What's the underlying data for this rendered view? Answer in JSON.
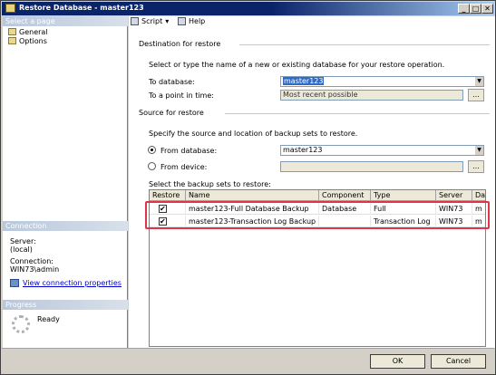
{
  "window": {
    "title": "Restore Database - master123",
    "min": "_",
    "max": "□",
    "close": "✕"
  },
  "sidebar": {
    "select_page_header": "Select a page",
    "items": [
      {
        "label": "General"
      },
      {
        "label": "Options"
      }
    ],
    "connection_header": "Connection",
    "server_label": "Server:",
    "server_value": "(local)",
    "connection_label": "Connection:",
    "connection_value": "WIN73\\admin",
    "view_props_link": "View connection properties",
    "progress_header": "Progress",
    "progress_status": "Ready"
  },
  "toolbar": {
    "script_label": "Script",
    "script_arrow": "▾",
    "help_label": "Help"
  },
  "destination": {
    "group_title": "Destination for restore",
    "description": "Select or type the name of a new or existing database for your restore operation.",
    "to_database_label": "To database:",
    "to_database_value": "master123",
    "point_in_time_label": "To a point in time:",
    "point_in_time_value": "Most recent possible",
    "ellipsis": "..."
  },
  "source": {
    "group_title": "Source for restore",
    "description": "Specify the source and location of backup sets to restore.",
    "from_database_label": "From database:",
    "from_database_value": "master123",
    "from_device_label": "From device:",
    "ellipsis": "...",
    "backup_sets_label": "Select the backup sets to restore:"
  },
  "backup_grid": {
    "columns": [
      "Restore",
      "Name",
      "Component",
      "Type",
      "Server",
      "Da"
    ],
    "rows": [
      {
        "restore": true,
        "name": "master123-Full Database Backup",
        "component": "Database",
        "type": "Full",
        "server": "WIN73",
        "da": "m"
      },
      {
        "restore": true,
        "name": "master123-Transaction Log  Backup",
        "component": "",
        "type": "Transaction Log",
        "server": "WIN73",
        "da": "m"
      }
    ]
  },
  "buttons": {
    "ok": "OK",
    "cancel": "Cancel"
  },
  "icons": {
    "combo_arrow": "▼"
  },
  "colors": {
    "title_bar": "#0a246a",
    "highlight_border": "#e0344a",
    "selection": "#316ac5"
  }
}
